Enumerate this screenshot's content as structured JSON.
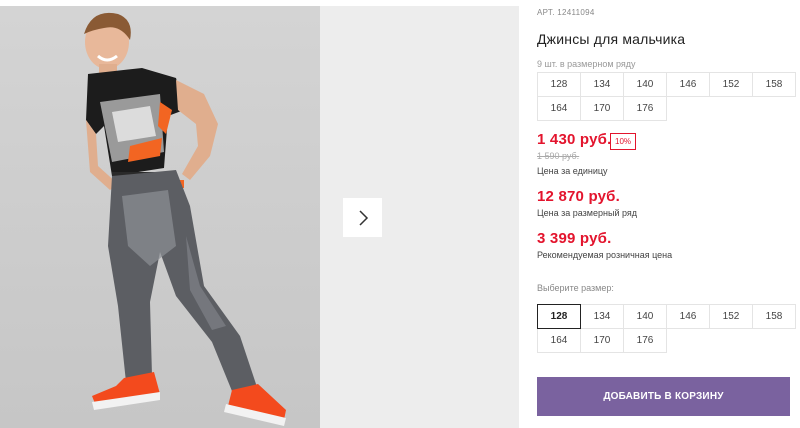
{
  "product": {
    "art": "АРТ. 12411094",
    "title": "Джинсы для мальчика",
    "row_note": "9 шт. в размерном ряду",
    "row_sizes": [
      "128",
      "134",
      "140",
      "146",
      "152",
      "158",
      "164",
      "170",
      "176"
    ],
    "price_unit": "1 430 руб.",
    "discount": "10%",
    "old_price": "1 590 руб.",
    "price_unit_caption": "Цена за единицу",
    "price_row": "12 870 руб.",
    "price_row_caption": "Цена за размерный ряд",
    "price_retail": "3 399 руб.",
    "price_retail_caption": "Рекомендуемая розничная цена",
    "size_label": "Выберите размер:",
    "select_sizes": [
      "128",
      "134",
      "140",
      "146",
      "152",
      "158",
      "164",
      "170",
      "176"
    ],
    "selected_size": "128",
    "add_to_cart": "ДОБАВИТЬ В КОРЗИНУ"
  },
  "colors": {
    "accent_price": "#e3142d",
    "cart_button": "#7a629f"
  }
}
